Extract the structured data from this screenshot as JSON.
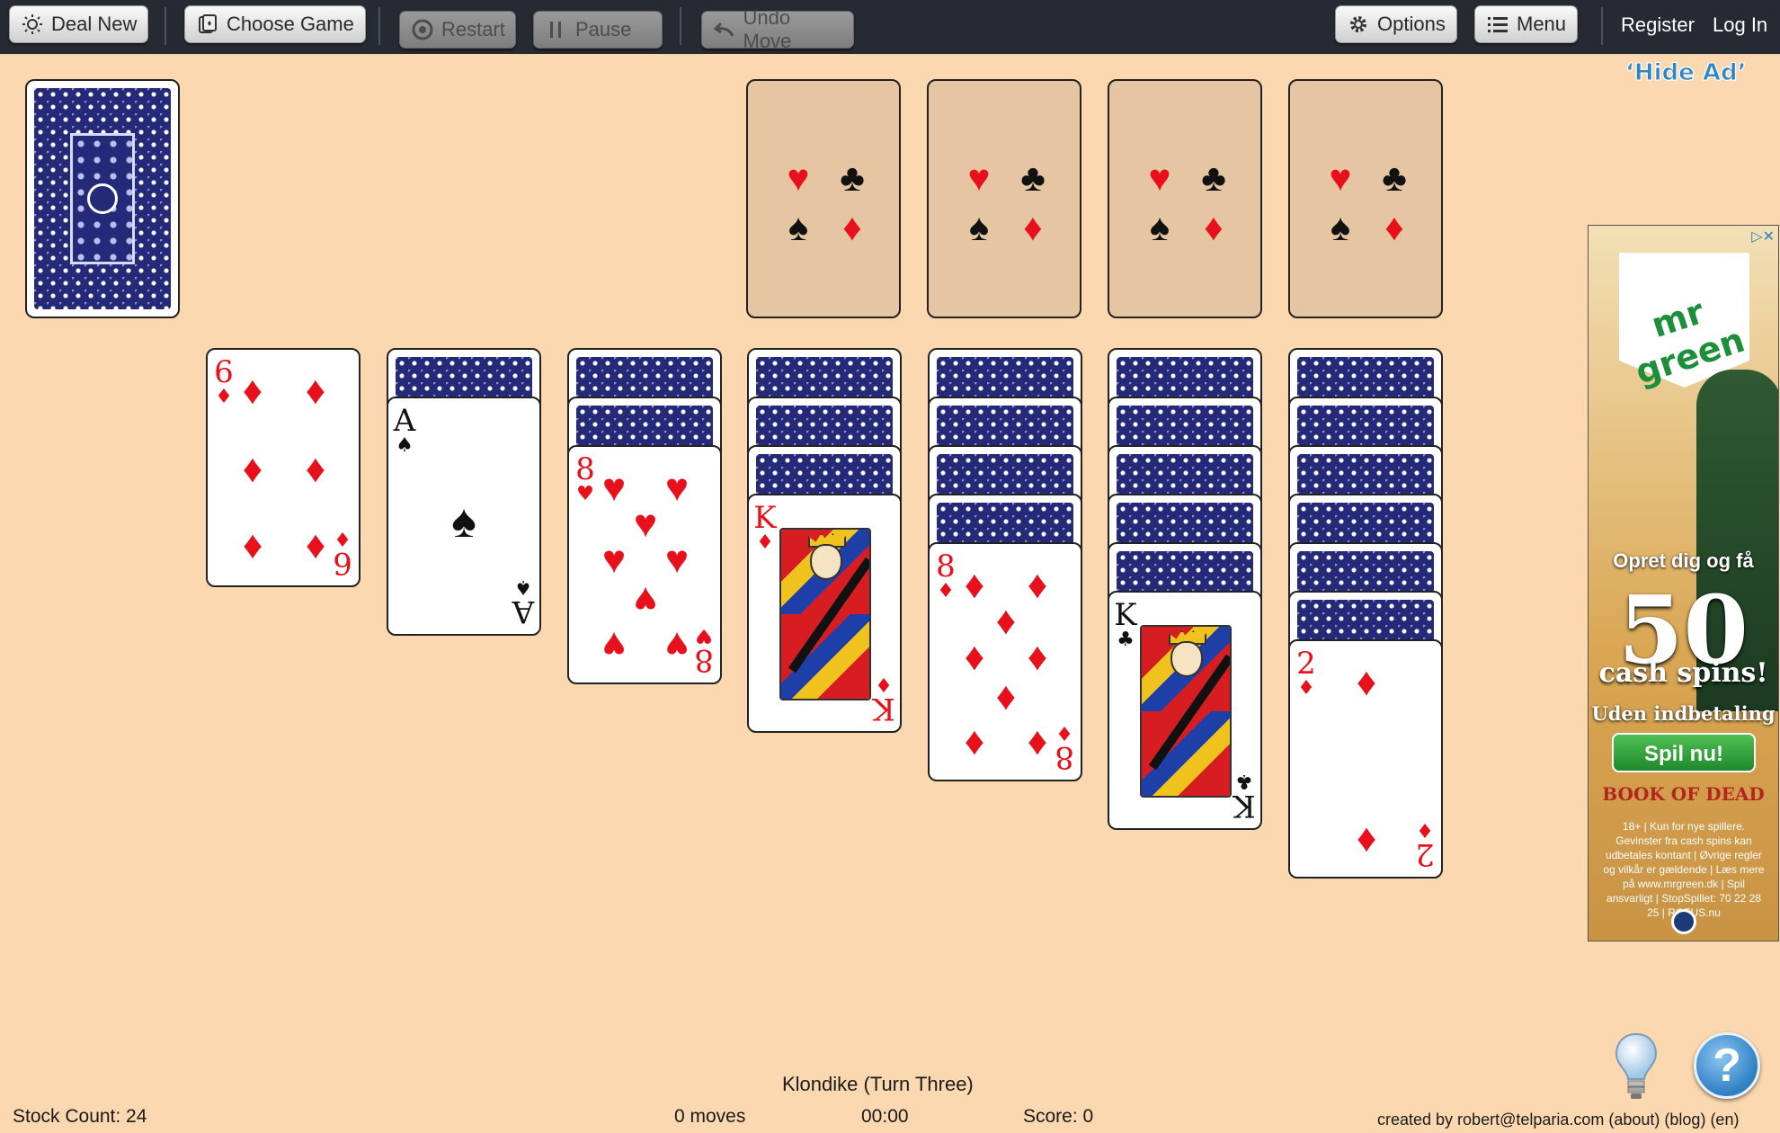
{
  "toolbar": {
    "deal_new": "Deal New",
    "choose_game": "Choose Game",
    "restart": "Restart",
    "pause": "Pause",
    "undo_move": "Undo Move",
    "options": "Options",
    "menu": "Menu",
    "register": "Register",
    "log_in": "Log In"
  },
  "hide_ad": "‘Hide Ad’",
  "foundation_suits": [
    "♥",
    "♣",
    "♠",
    "♦"
  ],
  "tableau": {
    "col1": {
      "rank": "6",
      "suit": "♦"
    },
    "col2": {
      "rank": "A",
      "suit": "♠"
    },
    "col3": {
      "rank": "8",
      "suit": "♥"
    },
    "col4": {
      "rank": "K",
      "suit": "♦"
    },
    "col5": {
      "rank": "8",
      "suit": "♦"
    },
    "col6": {
      "rank": "K",
      "suit": "♣"
    },
    "col7": {
      "rank": "2",
      "suit": "♦"
    }
  },
  "ad": {
    "brand": "mr green",
    "line1": "Opret dig og få",
    "line2": "50",
    "line3": "cash spins!",
    "line4": "Uden indbetaling",
    "cta": "Spil nu!",
    "game": "BOOK OF DEAD",
    "fine_print": "18+ | Kun for nye spillere. Gevinster fra cash spins kan udbetales kontant | Øvrige regler og vilkår er gældende | Læs mere på www.mrgreen.dk | Spil ansvarligt | StopSpillet: 70 22 28 25 | ROFUS.nu"
  },
  "status": {
    "game_title": "Klondike (Turn Three)",
    "stock_count": "Stock Count: 24",
    "moves": "0 moves",
    "timer": "00:00",
    "score": "Score: 0",
    "credits": "created by robert@telparia.com (about) (blog) (en)"
  },
  "help_label": "?",
  "colors": {
    "table": "#fcd8b0",
    "toolbar": "#262b33",
    "card_back": "#252a78",
    "red_suit": "#e8101a",
    "link": "#2d86c8"
  }
}
